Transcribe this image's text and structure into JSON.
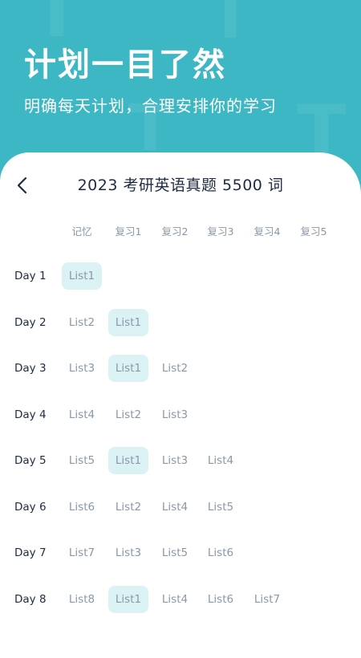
{
  "hero": {
    "title": "计划一目了然",
    "subtitle": "明确每天计划，合理安排你的学习"
  },
  "card": {
    "title": "2023 考研英语真题 5500 词",
    "back_icon": "chevron-left-icon"
  },
  "columns": [
    "记忆",
    "复习1",
    "复习2",
    "复习3",
    "复习4",
    "复习5"
  ],
  "colors": {
    "brand": "#3cb7c3",
    "highlight": "#dbf2f4",
    "text_dark": "#1f2a44",
    "text_muted": "#8a97a8"
  },
  "rows": [
    {
      "day": "Day 1",
      "cells": [
        "List1",
        "",
        "",
        "",
        "",
        ""
      ],
      "highlight": [
        0
      ]
    },
    {
      "day": "Day 2",
      "cells": [
        "List2",
        "List1",
        "",
        "",
        "",
        ""
      ],
      "highlight": [
        1
      ]
    },
    {
      "day": "Day 3",
      "cells": [
        "List3",
        "List1",
        "List2",
        "",
        "",
        ""
      ],
      "highlight": [
        1
      ]
    },
    {
      "day": "Day 4",
      "cells": [
        "List4",
        "List2",
        "List3",
        "",
        "",
        ""
      ],
      "highlight": []
    },
    {
      "day": "Day 5",
      "cells": [
        "List5",
        "List1",
        "List3",
        "List4",
        "",
        ""
      ],
      "highlight": [
        1
      ]
    },
    {
      "day": "Day 6",
      "cells": [
        "List6",
        "List2",
        "List4",
        "List5",
        "",
        ""
      ],
      "highlight": []
    },
    {
      "day": "Day 7",
      "cells": [
        "List7",
        "List3",
        "List5",
        "List6",
        "",
        ""
      ],
      "highlight": []
    },
    {
      "day": "Day 8",
      "cells": [
        "List8",
        "List1",
        "List4",
        "List6",
        "List7",
        ""
      ],
      "highlight": [
        1
      ]
    }
  ]
}
